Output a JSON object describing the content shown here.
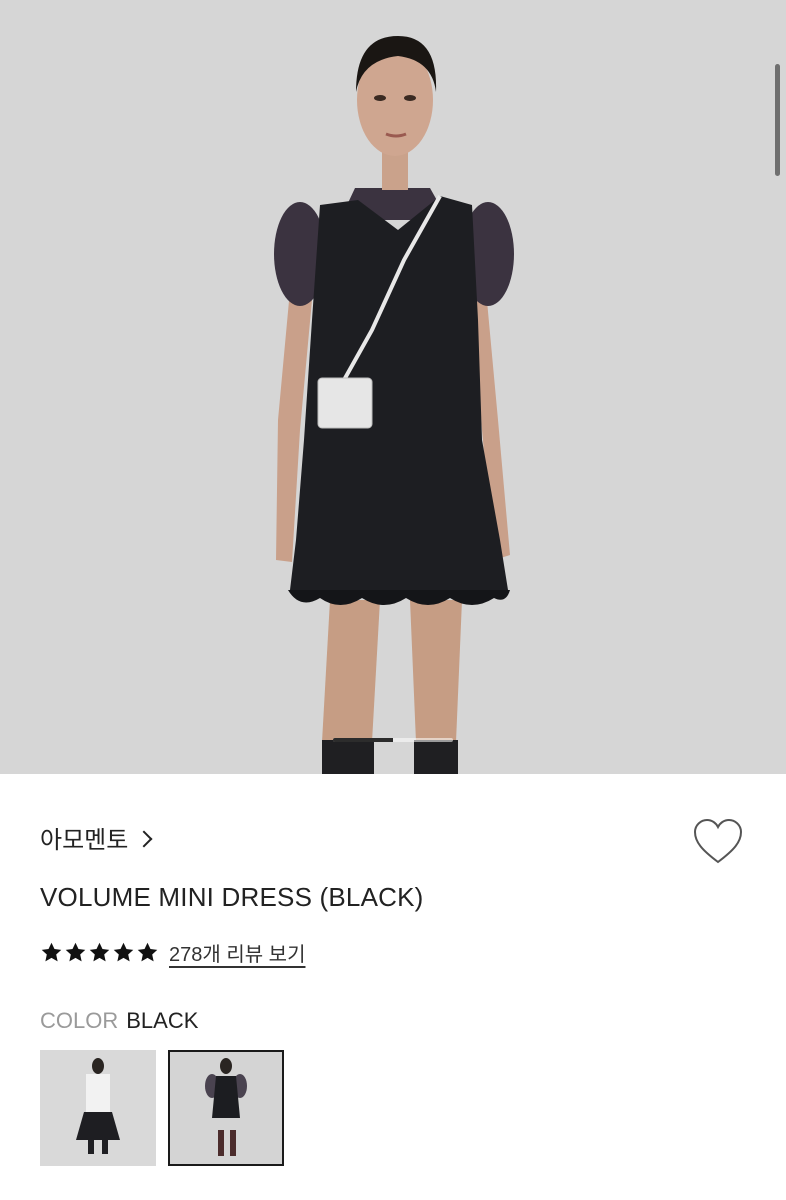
{
  "product": {
    "brand": "아모멘토",
    "title": "VOLUME MINI DRESS (BLACK)",
    "rating": 5,
    "review_link": "278개 리뷰 보기",
    "color_label": "COLOR",
    "color_value": "BLACK",
    "favorite": false
  },
  "gallery": {
    "image_alt": "model wearing black volume mini dress",
    "current_progress": 0.5
  },
  "variants": [
    {
      "name": "white",
      "selected": false
    },
    {
      "name": "black",
      "selected": true
    }
  ],
  "colors": {
    "background": "#d6d6d6",
    "text": "#222222",
    "muted": "#9a9a9a",
    "star": "#111111"
  },
  "icons": {
    "brand_chevron": "chevron-right-icon",
    "favorite": "heart-outline-icon",
    "star": "star-filled-icon"
  }
}
